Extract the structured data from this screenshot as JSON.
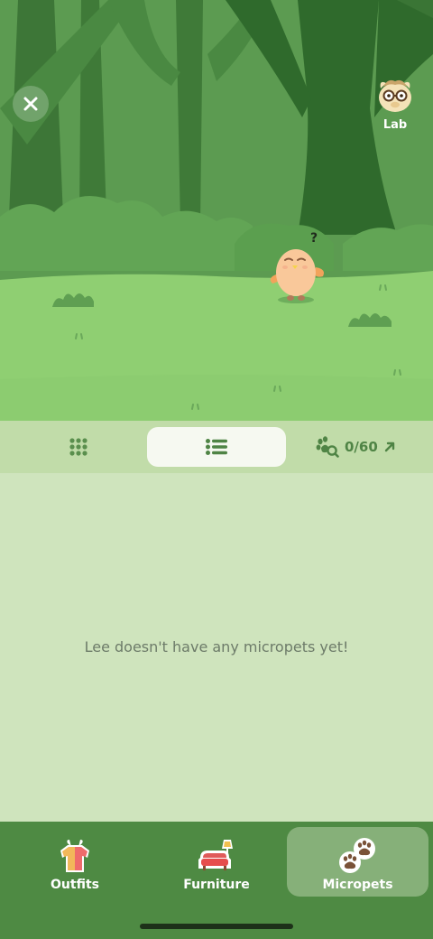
{
  "scene": {
    "close_icon": "close-icon",
    "lab": {
      "label": "Lab",
      "icon": "alpaca-glasses-icon"
    },
    "character": {
      "name": "chick-character",
      "status_glyph": "?"
    }
  },
  "toolbar": {
    "grid_icon": "grid-icon",
    "list_icon": "list-icon",
    "active_view": "list",
    "counter": {
      "icon": "paw-search-icon",
      "text": "0/60",
      "arrow_icon": "arrow-up-right-icon"
    }
  },
  "content": {
    "empty_message": "Lee doesn't have any micropets yet!"
  },
  "bottom_nav": {
    "tabs": [
      {
        "label": "Outfits",
        "icon": "shirt-icon",
        "active": false
      },
      {
        "label": "Furniture",
        "icon": "sofa-lamp-icon",
        "active": false
      },
      {
        "label": "Micropets",
        "icon": "paws-icon",
        "active": true
      }
    ]
  },
  "colors": {
    "forest_dark": "#3f7a38",
    "forest_mid": "#4f8a45",
    "grass": "#8fcf72",
    "toolbar_bg": "#c1dca9",
    "content_bg": "#cfe4bd",
    "nav_bg": "#4e8a43",
    "nav_active": "#86b079",
    "accent_green": "#4f8445"
  }
}
